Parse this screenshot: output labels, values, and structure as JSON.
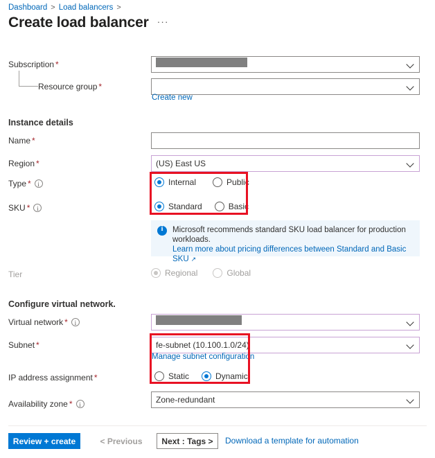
{
  "breadcrumb": {
    "items": [
      "Dashboard",
      "Load balancers"
    ],
    "separator": ">"
  },
  "header": {
    "title": "Create load balancer",
    "more_actions": "···"
  },
  "form": {
    "subscription": {
      "label": "Subscription",
      "required": "*",
      "value_redacted": true
    },
    "resource_group": {
      "label": "Resource group",
      "required": "*",
      "value": "",
      "create_new_link": "Create new"
    },
    "instance_details_heading": "Instance details",
    "name": {
      "label": "Name",
      "required": "*",
      "value": ""
    },
    "region": {
      "label": "Region",
      "required": "*",
      "value": "(US) East US"
    },
    "type": {
      "label": "Type",
      "required": "*",
      "options": [
        "Internal",
        "Public"
      ],
      "selected": "Internal"
    },
    "sku": {
      "label": "SKU",
      "required": "*",
      "options": [
        "Standard",
        "Basic"
      ],
      "selected": "Standard"
    },
    "sku_banner": {
      "text": "Microsoft recommends standard SKU load balancer for production workloads.",
      "link": "Learn more about pricing differences between Standard and Basic SKU",
      "external_icon": "↗"
    },
    "tier": {
      "label": "Tier",
      "options": [
        "Regional",
        "Global"
      ],
      "selected": "Regional",
      "disabled": true
    },
    "configure_vnet_heading": "Configure virtual network.",
    "virtual_network": {
      "label": "Virtual network",
      "required": "*",
      "value_redacted": true
    },
    "subnet": {
      "label": "Subnet",
      "required": "*",
      "value": "fe-subnet (10.100.1.0/24)",
      "manage_link": "Manage subnet configuration"
    },
    "ip_address_assignment": {
      "label": "IP address assignment",
      "required": "*",
      "options": [
        "Static",
        "Dynamic"
      ],
      "selected": "Dynamic"
    },
    "availability_zone": {
      "label": "Availability zone",
      "required": "*",
      "value": "Zone-redundant"
    }
  },
  "footer": {
    "review_create": "Review + create",
    "previous": "< Previous",
    "next": "Next : Tags >",
    "download_template": "Download a template for automation"
  },
  "colors": {
    "accent": "#0078d4",
    "link": "#0067b8",
    "required": "#a4262c",
    "annotation": "#e81123",
    "banner_bg": "#eff6fc",
    "violet_border": "#c8a2d4",
    "redaction": "#808080"
  }
}
